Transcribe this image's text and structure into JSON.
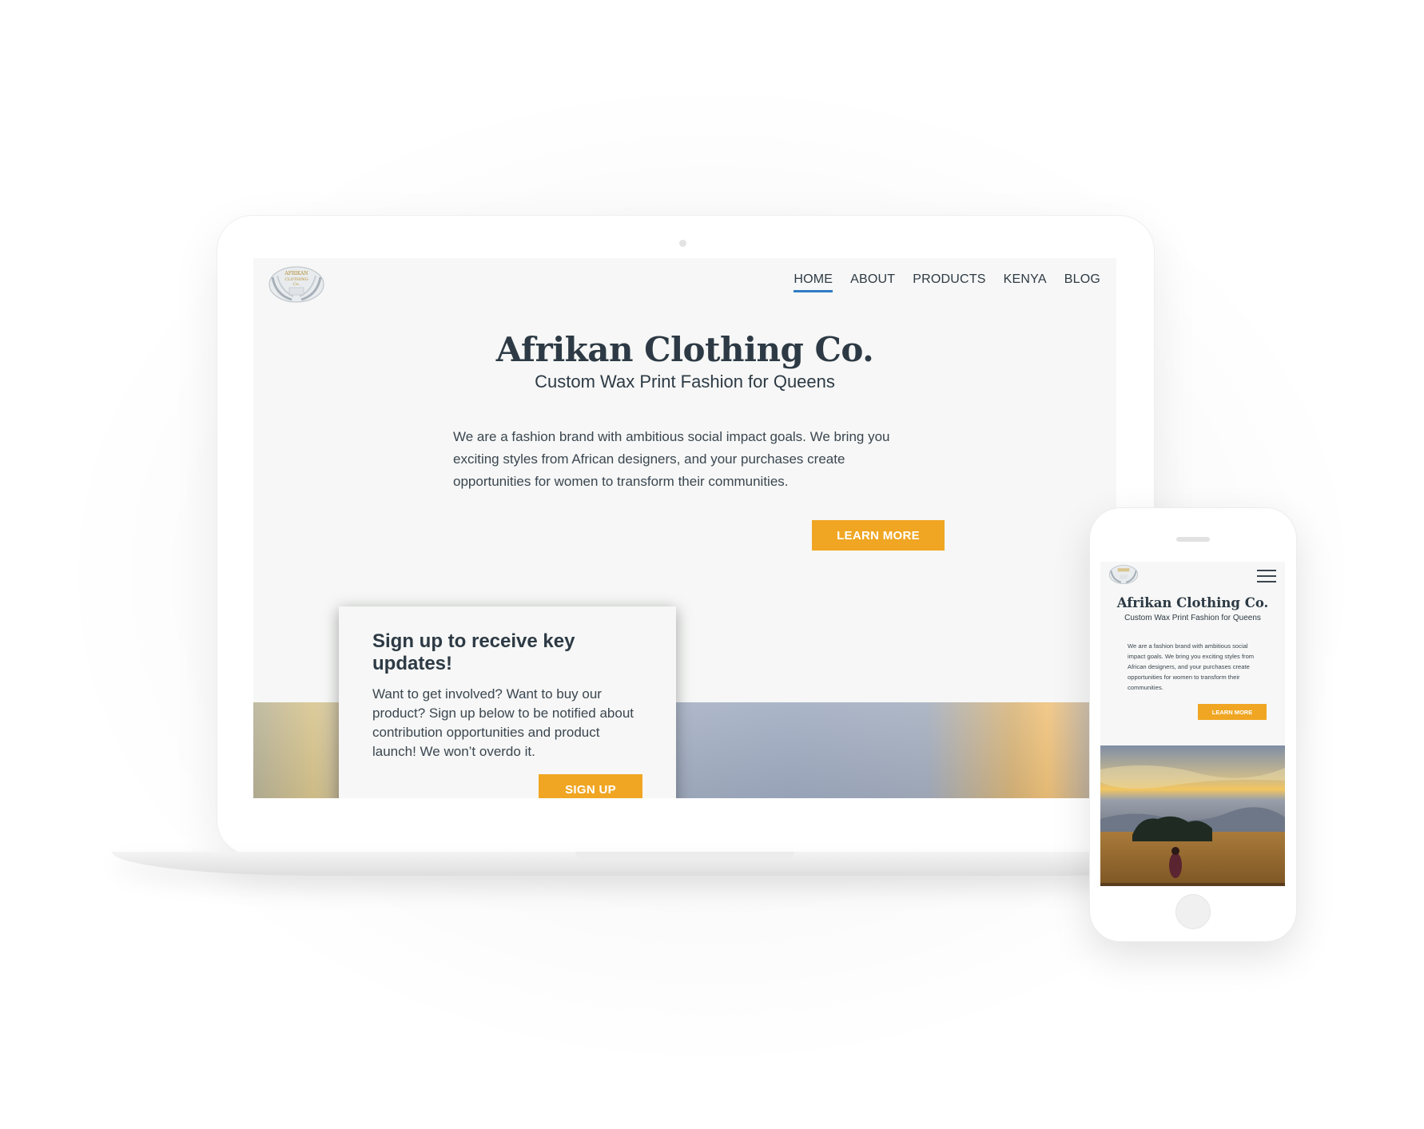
{
  "desktop": {
    "nav": {
      "items": [
        {
          "label": "HOME",
          "active": true
        },
        {
          "label": "ABOUT",
          "active": false
        },
        {
          "label": "PRODUCTS",
          "active": false
        },
        {
          "label": "KENYA",
          "active": false
        },
        {
          "label": "BLOG",
          "active": false
        }
      ]
    },
    "hero": {
      "title": "Afrikan Clothing Co.",
      "subtitle": "Custom Wax Print Fashion for Queens",
      "body": "We are a fashion brand with ambitious social impact goals. We bring you exciting styles from African designers, and your purchases create opportunities for women to transform their communities.",
      "cta_label": "LEARN MORE"
    },
    "signup": {
      "title": "Sign up to receive key updates!",
      "body": "Want to get involved? Want to buy our product? Sign up below to be notified about contribution opportunities and product launch! We won’t overdo it.",
      "button_label": "SIGN UP"
    }
  },
  "mobile": {
    "title": "Afrikan Clothing Co.",
    "subtitle": "Custom Wax Print Fashion for Queens",
    "body": "We are a fashion brand with ambitious social impact goals. We bring you exciting styles from African designers, and your purchases create opportunities for women to transform their communities.",
    "cta_label": "LEARN MORE",
    "menu_icon": "hamburger-menu-icon"
  },
  "logo": {
    "text_lines": [
      "AFRIKAN",
      "CLOTHING",
      "Co."
    ]
  },
  "colors": {
    "accent": "#f0a622",
    "nav_active_underline": "#2f7cc6",
    "text_dark": "#2d3a45",
    "page_bg": "#f6f7f6"
  }
}
